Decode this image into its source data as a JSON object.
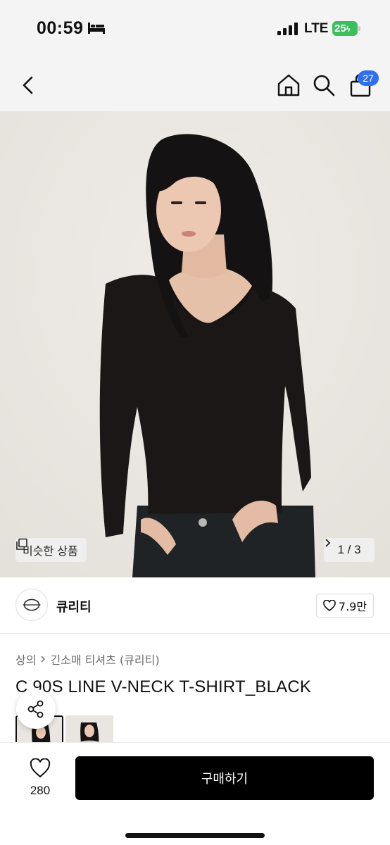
{
  "status_bar": {
    "time": "00:59",
    "network": "LTE",
    "battery": "25"
  },
  "nav": {
    "cart_count": "27",
    "icons": [
      "chevron-left-icon",
      "home-icon",
      "search-icon",
      "bag-icon"
    ]
  },
  "photo": {
    "similar_label": "비슷한 상품",
    "pager": "1 / 3"
  },
  "brand": {
    "name": "큐리티",
    "likes": "7.9만"
  },
  "breadcrumb": {
    "items": [
      "상의",
      "긴소매 티셔츠 (큐리티)"
    ]
  },
  "product": {
    "title": "C 90S LINE V-NECK T-SHIRT_BLACK"
  },
  "bottom": {
    "wish_count": "280",
    "buy_label": "구매하기"
  },
  "colors": {
    "badge": "#2f6ff2",
    "battery": "#3bbf5c",
    "buy_button": "#000000"
  }
}
